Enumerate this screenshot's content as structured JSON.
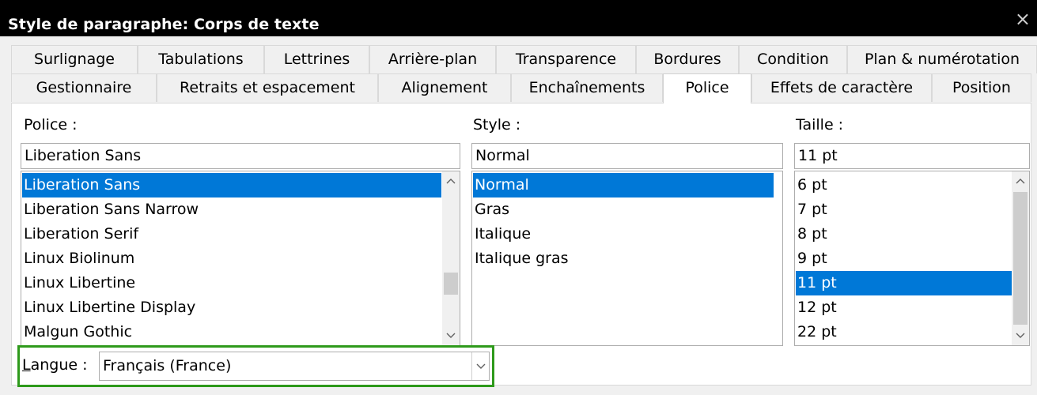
{
  "window": {
    "title": "Style de paragraphe: Corps de texte",
    "close_icon": "×"
  },
  "tabs_row1": [
    {
      "label": "Surlignage"
    },
    {
      "label": "Tabulations"
    },
    {
      "label": "Lettrines"
    },
    {
      "label": "Arrière-plan"
    },
    {
      "label": "Transparence"
    },
    {
      "label": "Bordures"
    },
    {
      "label": "Condition"
    },
    {
      "label": "Plan & numérotation"
    }
  ],
  "tabs_row2": [
    {
      "label": "Gestionnaire"
    },
    {
      "label": "Retraits et espacement"
    },
    {
      "label": "Alignement"
    },
    {
      "label": "Enchaînements"
    },
    {
      "label": "Police",
      "active": true
    },
    {
      "label": "Effets de caractère"
    },
    {
      "label": "Position"
    }
  ],
  "font": {
    "label": "Police :",
    "value": "Liberation Sans",
    "items": [
      "Liberation Sans",
      "Liberation Sans Narrow",
      "Liberation Serif",
      "Linux Biolinum",
      "Linux Libertine",
      "Linux Libertine Display",
      "Malgun Gothic"
    ],
    "selected": "Liberation Sans"
  },
  "style": {
    "label": "Style :",
    "value": "Normal",
    "items": [
      "Normal",
      "Gras",
      "Italique",
      "Italique gras"
    ],
    "selected": "Normal"
  },
  "size": {
    "label": "Taille :",
    "value": "11 pt",
    "items": [
      "6 pt",
      "7 pt",
      "8 pt",
      "9 pt",
      "11 pt",
      "12 pt",
      "22 pt"
    ],
    "selected": "11 pt"
  },
  "language": {
    "label_mnemonic": "L",
    "label_rest": "angue :",
    "value": "Français (France)"
  },
  "icons": {
    "scroll_up": "chevron-up-icon",
    "scroll_down": "chevron-down-icon",
    "dropdown": "chevron-down-icon"
  },
  "colors": {
    "selection": "#0078d7",
    "highlight_box": "#2e9a1b",
    "titlebar": "#000000"
  }
}
